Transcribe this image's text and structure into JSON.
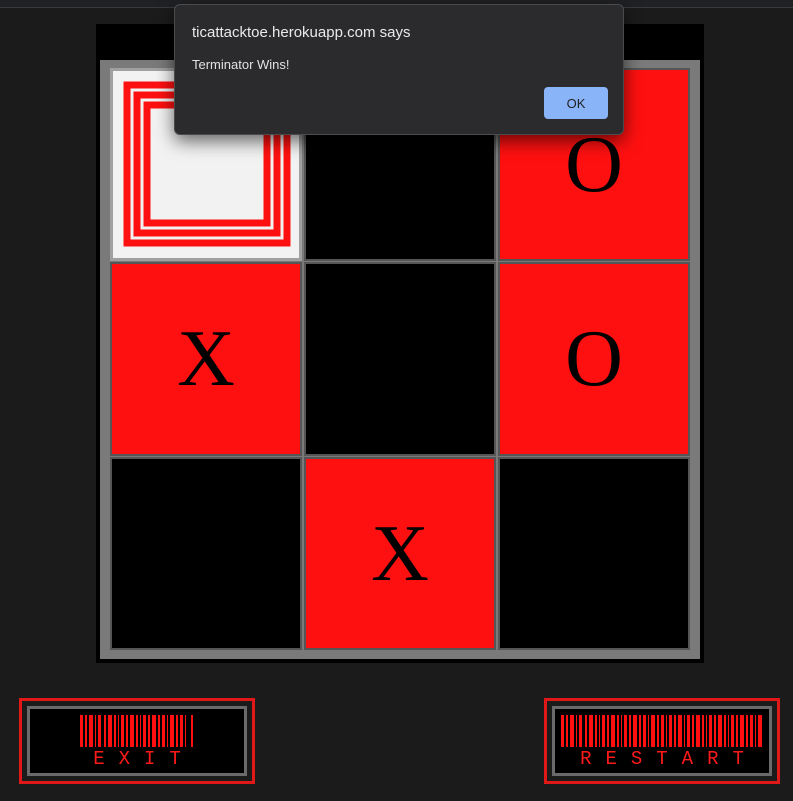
{
  "dialog": {
    "title": "ticattacktoe.herokuapp.com says",
    "message": "Terminator Wins!",
    "ok_label": "OK"
  },
  "board": {
    "cells": [
      "",
      "",
      "O",
      "X",
      "",
      "O",
      "",
      "X",
      ""
    ],
    "cell_colors": [
      "highlight",
      "black",
      "red",
      "red",
      "black",
      "red",
      "black",
      "red",
      "black"
    ]
  },
  "buttons": {
    "exit_label": "EXIT",
    "restart_label": "RESTART"
  },
  "colors": {
    "accent_red": "#ff1010",
    "highlight": "#f2f2f2",
    "dialog_button": "#8ab4f8"
  }
}
